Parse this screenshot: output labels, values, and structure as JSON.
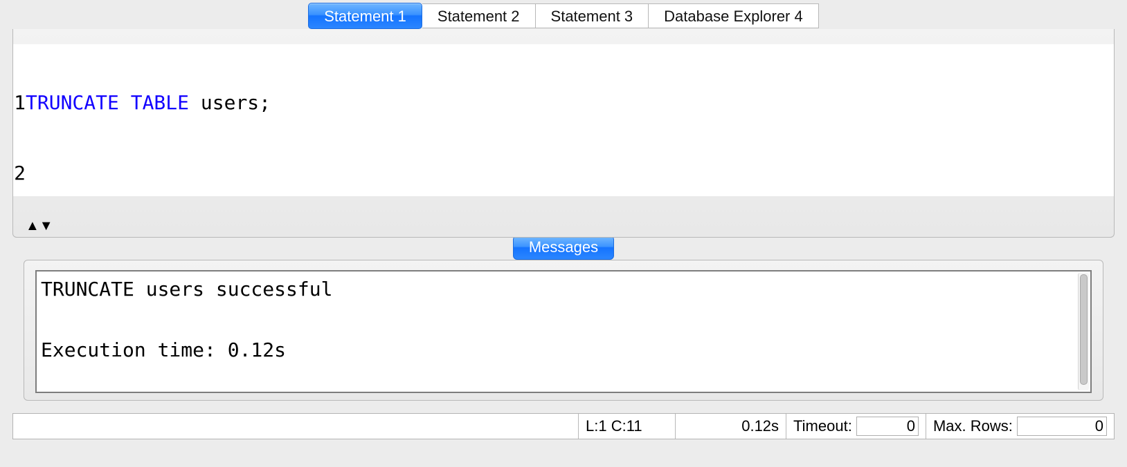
{
  "tabs": [
    {
      "label": "Statement 1",
      "active": true
    },
    {
      "label": "Statement 2",
      "active": false
    },
    {
      "label": "Statement 3",
      "active": false
    },
    {
      "label": "Database Explorer 4",
      "active": false
    }
  ],
  "editor": {
    "line_numbers": [
      "1",
      "2"
    ],
    "code": {
      "line1_keyword": "TRUNCATE TABLE",
      "line1_rest": " users;",
      "line2": ""
    }
  },
  "messages_tab_label": "Messages",
  "messages": {
    "line1": "TRUNCATE users successful",
    "line2": "",
    "line3": "Execution time: 0.12s"
  },
  "status": {
    "cursor_position": "L:1 C:11",
    "exec_time": "0.12s",
    "timeout_label": "Timeout:",
    "timeout_value": "0",
    "maxrows_label": "Max. Rows:",
    "maxrows_value": "0"
  }
}
